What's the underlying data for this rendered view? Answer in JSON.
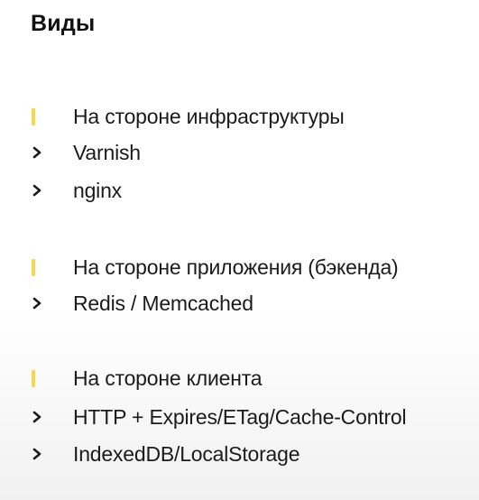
{
  "title": "Виды",
  "accent_color": "#f7d84a",
  "bullet_icon": "chevron-right-icon",
  "sections": [
    {
      "heading": "На стороне инфраструктуры",
      "items": [
        "Varnish",
        "nginx"
      ]
    },
    {
      "heading": "На стороне приложения (бэкенда)",
      "items": [
        "Redis / Memcached"
      ]
    },
    {
      "heading": "На стороне клиента",
      "items": [
        "HTTP + Expires/ETag/Cache-Control",
        "IndexedDB/LocalStorage"
      ]
    }
  ]
}
